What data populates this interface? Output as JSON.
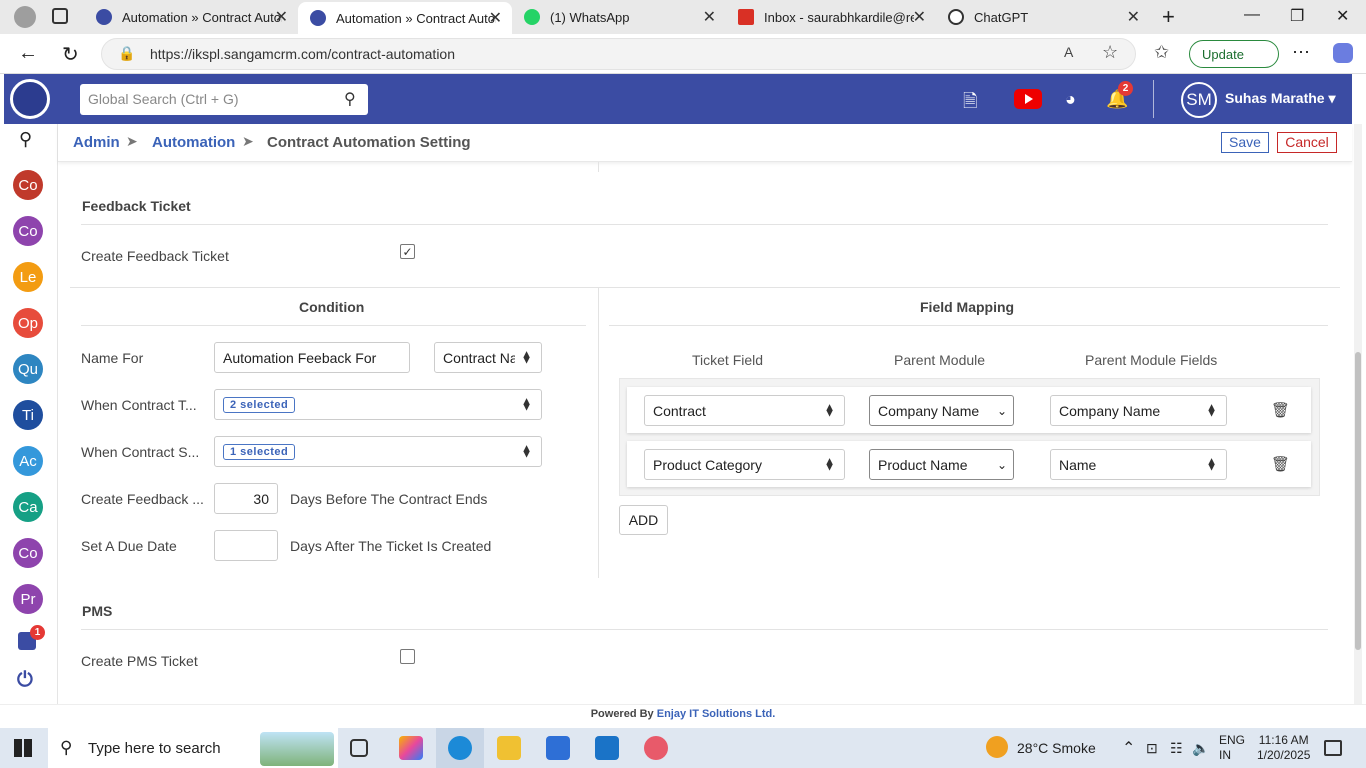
{
  "browser": {
    "tabs": [
      {
        "title": "Automation » Contract Automation",
        "active": false
      },
      {
        "title": "Automation » Contract Automation",
        "active": true
      },
      {
        "title": "(1) WhatsApp",
        "active": false
      },
      {
        "title": "Inbox - saurabhkardile@reliance",
        "active": false
      },
      {
        "title": "ChatGPT",
        "active": false
      }
    ],
    "url": "https://ikspl.sangamcrm.com/contract-automation",
    "update_label": "Update"
  },
  "header": {
    "search_placeholder": "Global Search (Ctrl + G)",
    "notification_count": "2",
    "user_initials": "SM",
    "user_name": "Suhas Marathe"
  },
  "sidebar": {
    "items": [
      {
        "label": "Co",
        "color": "#c0392b"
      },
      {
        "label": "Co",
        "color": "#8e44ad"
      },
      {
        "label": "Le",
        "color": "#f39c12"
      },
      {
        "label": "Op",
        "color": "#e74c3c"
      },
      {
        "label": "Qu",
        "color": "#2e86c1"
      },
      {
        "label": "Ti",
        "color": "#1f4e9e"
      },
      {
        "label": "Ac",
        "color": "#3498db"
      },
      {
        "label": "Ca",
        "color": "#16a085"
      },
      {
        "label": "Co",
        "color": "#8e44ad"
      },
      {
        "label": "Pr",
        "color": "#8e44ad"
      }
    ],
    "inbox_badge": "1"
  },
  "breadcrumb": {
    "admin": "Admin",
    "automation": "Automation",
    "current": "Contract Automation Setting",
    "sep": "➤"
  },
  "actions": {
    "save": "Save",
    "cancel": "Cancel"
  },
  "feedback": {
    "section_title": "Feedback Ticket",
    "create_label": "Create Feedback Ticket",
    "create_checked": true
  },
  "condition": {
    "title": "Condition",
    "name_for_label": "Name For",
    "name_for_value": "Automation Feeback For",
    "name_for_select": "Contract Na",
    "when_type_label": "When Contract T...",
    "when_type_value": "2 selected",
    "when_status_label": "When Contract S...",
    "when_status_value": "1 selected",
    "create_before_label": "Create Feedback ...",
    "create_before_value": "30",
    "create_before_suffix": "Days Before The Contract Ends",
    "due_label": "Set A Due Date",
    "due_value": "",
    "due_suffix": "Days After The Ticket Is Created"
  },
  "mapping": {
    "title": "Field Mapping",
    "columns": [
      "Ticket Field",
      "Parent Module",
      "Parent Module Fields"
    ],
    "rows": [
      {
        "ticket_field": "Contract",
        "parent_module": "Company Name",
        "parent_field": "Company Name"
      },
      {
        "ticket_field": "Product Category",
        "parent_module": "Product Name",
        "parent_field": "Name"
      }
    ],
    "add_label": "ADD"
  },
  "pms": {
    "section_title": "PMS",
    "create_label": "Create PMS Ticket",
    "create_checked": false
  },
  "footer": {
    "prefix": "Powered By",
    "company": "Enjay IT Solutions Ltd."
  },
  "taskbar": {
    "search_placeholder": "Type here to search",
    "weather": "28°C  Smoke",
    "lang_top": "ENG",
    "lang_bottom": "IN",
    "time": "11:16 AM",
    "date": "1/20/2025"
  },
  "colors": {
    "header_blue": "#3b4ca3",
    "link_blue": "#3b63b8",
    "cancel_red": "#c62828"
  }
}
